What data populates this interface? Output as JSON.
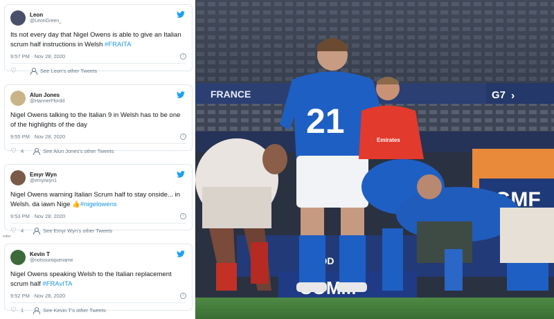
{
  "tweets": [
    {
      "name": "Leon",
      "handle": "@LeonGreen_",
      "text": "Its not every day that Nigel Owens is able to give an Italian scrum half instructions in Welsh ",
      "hashtags": "#FRAITA",
      "time": "9:57 PM · Nov 28, 2020",
      "likes": "",
      "other": "See Leon's other Tweets",
      "avatar_color": "#4a4f6a"
    },
    {
      "name": "Alun Jones",
      "handle": "@HannerFfordd",
      "text": "Nigel Owens talking to the Italian 9 in Welsh has to be one of the highlights of the day",
      "hashtags": "",
      "time": "9:55 PM · Nov 28, 2020",
      "likes": "4",
      "other": "See Alun Jones's other Tweets",
      "avatar_color": "#c9b48a"
    },
    {
      "name": "Emyr Wyn",
      "handle": "@emyrwyn1",
      "text": "Nigel Owens warning Italian Scrum half to stay onside... in Welsh. da iawn Nige 👍",
      "hashtags": "#nigelowens",
      "time": "9:53 PM · Nov 28, 2020",
      "likes": "4",
      "other": "See Emyr Wyn's other Tweets",
      "avatar_color": "#7a5a48"
    },
    {
      "name": "Kevin T",
      "handle": "@notsouniquename",
      "text": "Nigel Owens speaking Welsh to the Italian replacement scrum half  ",
      "hashtags": "#FRAvITA",
      "time": "9:52 PM · Nov 28, 2020",
      "likes": "1",
      "other": "See Kevin T's other Tweets",
      "avatar_color": "#3c6a3a"
    }
  ],
  "credit_text": "witter",
  "photo": {
    "jersey_number": "21",
    "board_left": "FRANCE",
    "board_right": "G7",
    "referee_shirt": "Emirates",
    "sponsor_right": "GMF",
    "pitch_board": "COMM",
    "pitch_board_2": "FOOD"
  },
  "colors": {
    "twitter_blue": "#1da1f2",
    "italy_blue": "#1e5fc4",
    "referee_red": "#e23a2c",
    "pitch_green": "#3f7a3a"
  }
}
